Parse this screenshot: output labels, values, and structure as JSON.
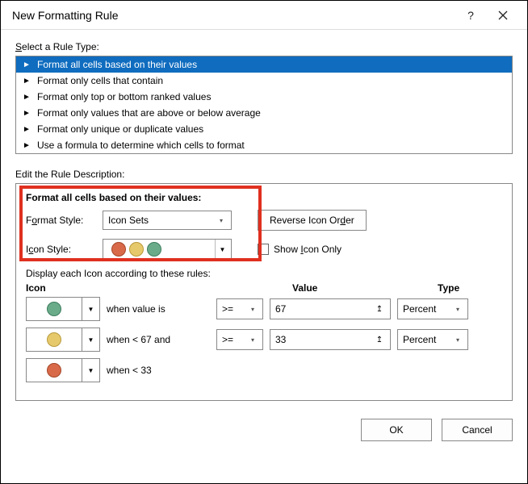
{
  "title": "New Formatting Rule",
  "help_symbol": "?",
  "sections": {
    "rule_type_label": "Select a Rule Type:",
    "rule_types": [
      "Format all cells based on their values",
      "Format only cells that contain",
      "Format only top or bottom ranked values",
      "Format only values that are above or below average",
      "Format only unique or duplicate values",
      "Use a formula to determine which cells to format"
    ],
    "selected_rule_index": 0,
    "edit_desc_label": "Edit the Rule Description:",
    "desc_heading": "Format all cells based on their values:",
    "format_style_label": "Format Style:",
    "format_style_value": "Icon Sets",
    "reverse_btn": "Reverse Icon Order",
    "icon_style_label": "Icon Style:",
    "show_icon_only_label": "Show Icon Only",
    "display_rules_label": "Display each Icon according to these rules:",
    "col_icon": "Icon",
    "col_value": "Value",
    "col_type": "Type",
    "rules": [
      {
        "color": "green",
        "when_text": "when value is",
        "op": ">=",
        "value": "67",
        "type": "Percent"
      },
      {
        "color": "yellow",
        "when_text": "when < 67 and",
        "op": ">=",
        "value": "33",
        "type": "Percent"
      },
      {
        "color": "red",
        "when_text": "when < 33",
        "op": "",
        "value": "",
        "type": ""
      }
    ]
  },
  "buttons": {
    "ok": "OK",
    "cancel": "Cancel"
  }
}
